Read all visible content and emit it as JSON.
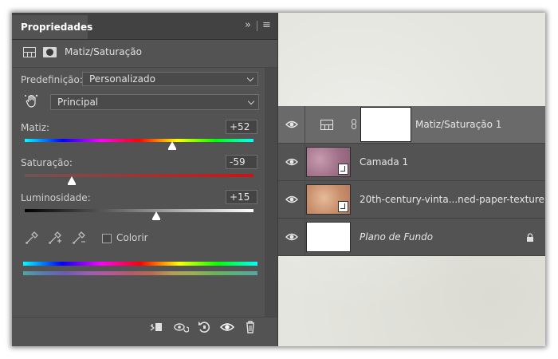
{
  "properties_panel": {
    "tab_label": "Propriedades",
    "panel_menu_icon": "panel-menu-icon",
    "collapse_icon": "collapse-panels-icon",
    "collapse_glyph": "»",
    "menu_glyph": "≡",
    "title": "Matiz/Saturação",
    "preset_label": "Predefinição:",
    "preset_value": "Personalizado",
    "channel_value": "Principal",
    "hue": {
      "label": "Matiz:",
      "value": "+52",
      "numeric": 52,
      "min": -180,
      "max": 180
    },
    "saturation": {
      "label": "Saturação:",
      "value": "-59",
      "numeric": -59,
      "min": -100,
      "max": 100
    },
    "lightness": {
      "label": "Luminosidade:",
      "value": "+15",
      "numeric": 15,
      "min": -100,
      "max": 100
    },
    "colorize_label": "Colorir",
    "colorize_checked": false,
    "bottom_icons": [
      "clip-to-layer-icon",
      "view-previous-state-icon",
      "reset-icon",
      "visibility-eye-icon",
      "trash-icon"
    ]
  },
  "layers_panel": {
    "layers": [
      {
        "name": "Matiz/Saturação 1",
        "type": "adjustment",
        "selected": true,
        "visible": true
      },
      {
        "name": "Camada 1",
        "type": "smart-object",
        "selected": false,
        "visible": true
      },
      {
        "name": "20th-century-vinta...ned-paper-texture",
        "type": "smart-object",
        "selected": false,
        "visible": true
      },
      {
        "name": "Plano de Fundo",
        "type": "background",
        "selected": false,
        "visible": true,
        "locked": true
      }
    ]
  },
  "colors": {
    "panel_bg": "#535353",
    "tab_bg": "#424242",
    "selected_row": "#6a6a6a",
    "sat_track_left": "#6e5555",
    "sat_track_right": "#cc1414"
  }
}
